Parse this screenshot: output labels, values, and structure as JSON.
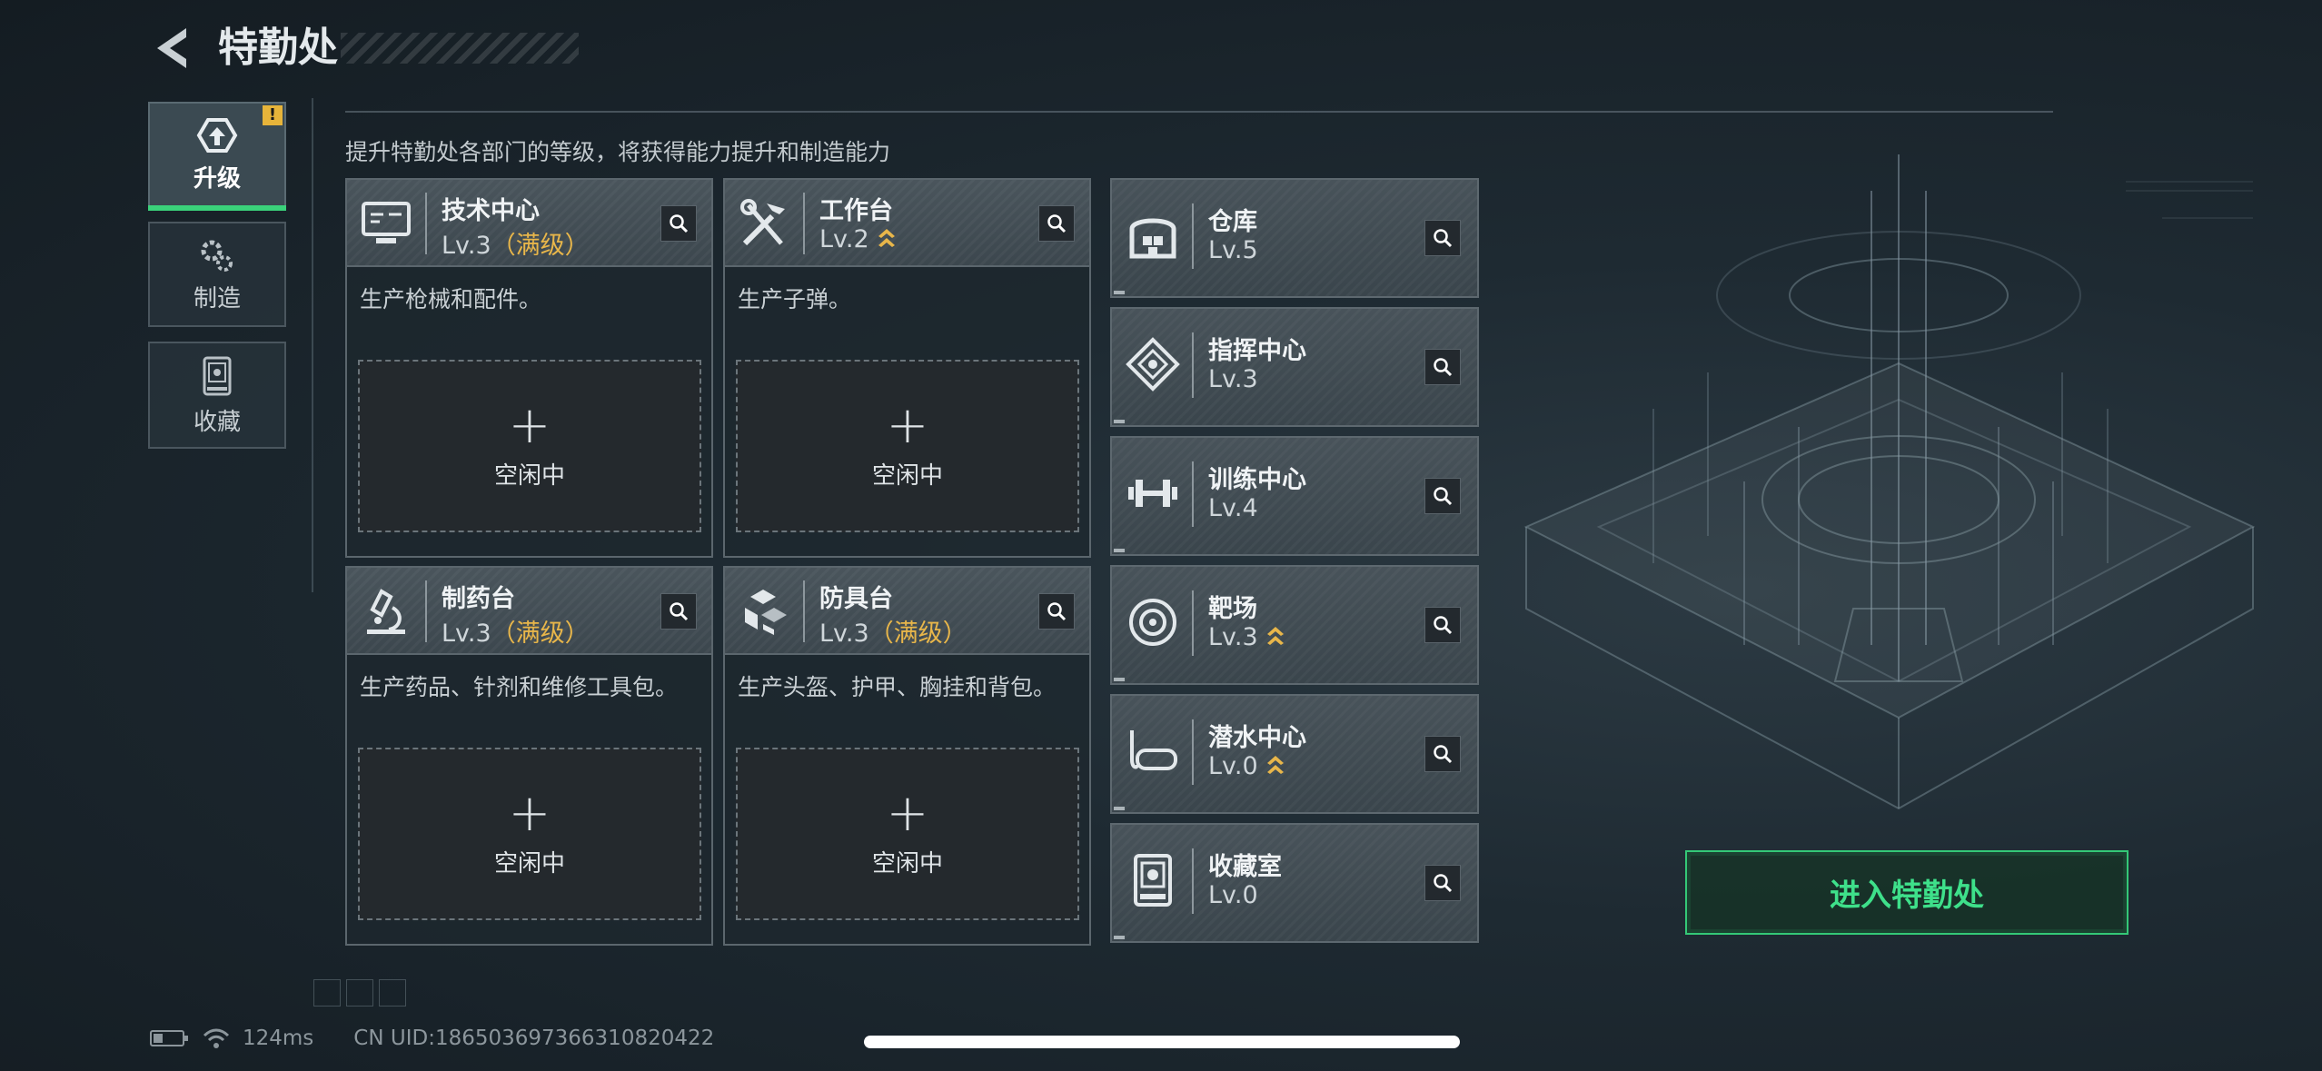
{
  "header": {
    "title": "特勤处"
  },
  "tabs": [
    {
      "label": "升级",
      "icon": "upgrade-icon",
      "active": true,
      "badge": "!"
    },
    {
      "label": "制造",
      "icon": "gears-icon",
      "active": false
    },
    {
      "label": "收藏",
      "icon": "trophy-case-icon",
      "active": false
    }
  ],
  "hint": "提升特勤处各部门的等级，将获得能力提升和制造能力",
  "big_cards": [
    {
      "name": "技术中心",
      "level": "Lv.3",
      "max": "（满级）",
      "desc": "生产枪械和配件。",
      "slot": "空闲中",
      "icon": "computer-icon"
    },
    {
      "name": "工作台",
      "level": "Lv.2",
      "max": "",
      "desc": "生产子弹。",
      "slot": "空闲中",
      "icon": "tools-icon",
      "upgradable": true
    },
    {
      "name": "制药台",
      "level": "Lv.3",
      "max": "（满级）",
      "desc": "生产药品、针剂和维修工具包。",
      "slot": "空闲中",
      "icon": "microscope-icon"
    },
    {
      "name": "防具台",
      "level": "Lv.3",
      "max": "（满级）",
      "desc": "生产头盔、护甲、胸挂和背包。",
      "slot": "空闲中",
      "icon": "armor-blocks-icon"
    }
  ],
  "small_cards": [
    {
      "name": "仓库",
      "level": "Lv.5",
      "icon": "warehouse-icon",
      "upgradable": false
    },
    {
      "name": "指挥中心",
      "level": "Lv.3",
      "icon": "command-icon",
      "upgradable": false
    },
    {
      "name": "训练中心",
      "level": "Lv.4",
      "icon": "dumbbell-icon",
      "upgradable": false
    },
    {
      "name": "靶场",
      "level": "Lv.3",
      "icon": "target-icon",
      "upgradable": true
    },
    {
      "name": "潜水中心",
      "level": "Lv.0",
      "icon": "diving-mask-icon",
      "upgradable": true
    },
    {
      "name": "收藏室",
      "level": "Lv.0",
      "icon": "trophy-case-icon",
      "upgradable": false
    }
  ],
  "enter_button": "进入特勤处",
  "status": {
    "ping": "124ms",
    "uid": "CN UID:1865036973663108204​22"
  },
  "colors": {
    "accent_green": "#3ee08a",
    "max_level": "#e8b64a",
    "badge": "#e7b43a"
  }
}
